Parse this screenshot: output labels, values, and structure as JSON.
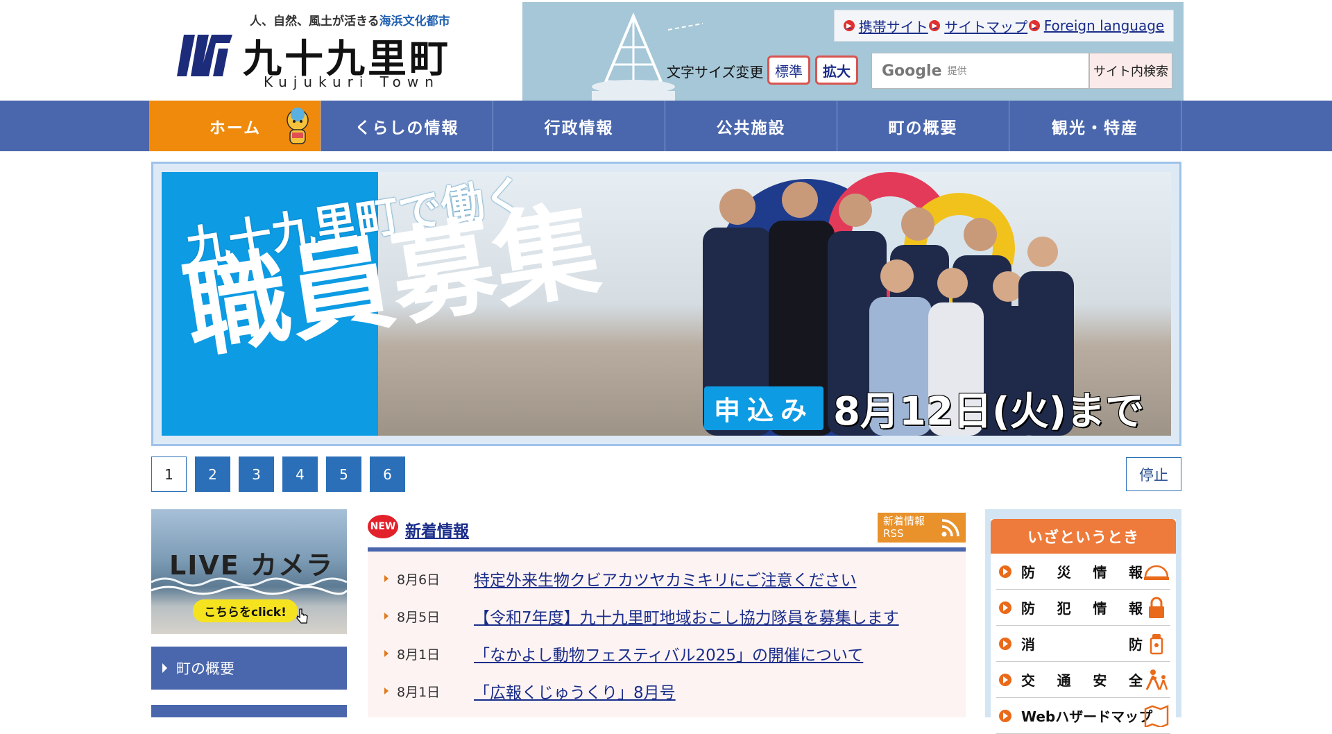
{
  "header": {
    "tagline_prefix": "人、自然、風土が活きる",
    "tagline_highlight": "海浜文化都市",
    "logo_text": "九十九里町",
    "logo_roman": "Kujukuri Town"
  },
  "utility": {
    "links": [
      {
        "label": "携帯サイト"
      },
      {
        "label": "サイトマップ"
      },
      {
        "label": "Foreign language"
      }
    ],
    "font_size_label": "文字サイズ変更",
    "font_standard": "標準",
    "font_large": "拡大",
    "search_brand": "Google",
    "search_brand_sub": "提供",
    "search_button": "サイト内検索"
  },
  "nav": {
    "items": [
      {
        "label": "ホーム"
      },
      {
        "label": "くらしの情報"
      },
      {
        "label": "行政情報"
      },
      {
        "label": "公共施設"
      },
      {
        "label": "町の概要"
      },
      {
        "label": "観光・特産"
      }
    ]
  },
  "banner": {
    "line1": "九十九里町で働く",
    "line2": "職員募集",
    "apply": "申込み",
    "deadline": "8月12日(火)まで"
  },
  "pager": {
    "pages": [
      "1",
      "2",
      "3",
      "4",
      "5",
      "6"
    ],
    "active": "1",
    "stop_label": "停止"
  },
  "left": {
    "live_title": "LIVE カメラ",
    "live_cta": "こちらをclick!",
    "menu_item": "町の概要"
  },
  "news": {
    "badge": "NEW",
    "title": "新着情報",
    "rss_line1": "新着情報",
    "rss_line2": "RSS",
    "items": [
      {
        "date": "8月6日",
        "title": "特定外来生物クビアカツヤカミキリにご注意ください"
      },
      {
        "date": "8月5日",
        "title": "【令和7年度】九十九里町地域おこし協力隊員を募集します"
      },
      {
        "date": "8月1日",
        "title": "「なかよし動物フェスティバル2025」の開催について"
      },
      {
        "date": "8月1日",
        "title": "「広報くじゅうくり」8月号"
      }
    ]
  },
  "emergency": {
    "title": "いざというとき",
    "items": [
      {
        "label": "防災情報",
        "icon": "helmet-icon"
      },
      {
        "label": "防犯情報",
        "icon": "padlock-icon"
      },
      {
        "label": "消防",
        "icon": "hydrant-icon"
      },
      {
        "label": "交通安全",
        "icon": "pedestrians-icon"
      },
      {
        "label": "Webハザードマップ",
        "icon": "map-icon"
      }
    ]
  },
  "colors": {
    "nav_blue": "#4a67ad",
    "home_orange": "#ef8a0c",
    "banner_blue": "#0d9be3",
    "link_blue": "#1a2d8a",
    "rss_orange": "#e9912a",
    "emergency_orange": "#ee7b3b"
  }
}
